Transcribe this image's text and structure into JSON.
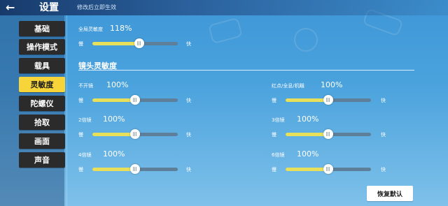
{
  "header": {
    "back_symbol": "←",
    "title": "设置",
    "notice": "修改后立即生效"
  },
  "sidebar": {
    "items": [
      {
        "label": "基础",
        "active": false
      },
      {
        "label": "操作模式",
        "active": false
      },
      {
        "label": "载具",
        "active": false
      },
      {
        "label": "灵敏度",
        "active": true
      },
      {
        "label": "陀螺仪",
        "active": false
      },
      {
        "label": "拾取",
        "active": false
      },
      {
        "label": "画面",
        "active": false
      },
      {
        "label": "声音",
        "active": false
      }
    ]
  },
  "global": {
    "label": "全局灵敏度",
    "value_text": "118%",
    "fraction": 0.55,
    "slow": "慢",
    "fast": "快"
  },
  "camera": {
    "title": "镜头灵敏度",
    "sliders": [
      {
        "label": "不开镜",
        "value_text": "100%",
        "fraction": 0.5,
        "slow": "慢",
        "fast": "快"
      },
      {
        "label": "红点/全息/机瞄",
        "value_text": "100%",
        "fraction": 0.5,
        "slow": "慢",
        "fast": "快"
      },
      {
        "label": "2倍镜",
        "value_text": "100%",
        "fraction": 0.5,
        "slow": "慢",
        "fast": "快"
      },
      {
        "label": "3倍镜",
        "value_text": "100%",
        "fraction": 0.5,
        "slow": "慢",
        "fast": "快"
      },
      {
        "label": "4倍镜",
        "value_text": "100%",
        "fraction": 0.5,
        "slow": "慢",
        "fast": "快"
      },
      {
        "label": "6倍镜",
        "value_text": "100%",
        "fraction": 0.5,
        "slow": "慢",
        "fast": "快"
      }
    ]
  },
  "reset_label": "恢复默认",
  "colors": {
    "accent": "#f6d43a",
    "fill": "#e8e05a",
    "track": "#5d7f9a"
  }
}
